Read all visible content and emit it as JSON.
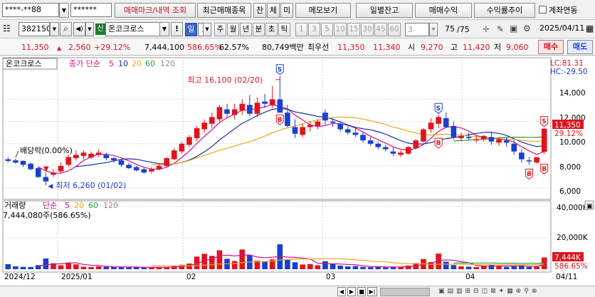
{
  "top": {
    "account": "****-**88",
    "password": "******",
    "buttons": [
      "매매마크/내역 조회",
      "최근매매종목",
      "잔",
      "체",
      "미",
      "메모보기",
      "일별잔고",
      "매매수익",
      "수익률추이"
    ],
    "link_check_label": "계좌연동"
  },
  "toolbar": {
    "code": "382150",
    "credit_badge": "신",
    "stock_name": "온코크로스",
    "exclaim": "!",
    "period_selected": "일",
    "period_value": "3",
    "periods": [
      "주",
      "월",
      "년",
      "분",
      "초",
      "틱"
    ],
    "intervals": [
      "1",
      "3",
      "5",
      "10",
      "15",
      "30",
      "45",
      "60"
    ],
    "interval_value": "3",
    "count_label": "75",
    "count_total": "/75",
    "date": "2025/04/11"
  },
  "quote": {
    "price": "11,350",
    "change": "2,560",
    "change_pct": "+29.12%",
    "volume": "7,444,100",
    "vol_ratio": "586.65%",
    "turnover": "62.57%",
    "amount": "80,749백만",
    "best_bid_label": "최우선",
    "ask": "11,350",
    "bid": "11,340",
    "open_label": "시",
    "open": "9,270",
    "high_label": "고",
    "high": "11,420",
    "low_label": "저",
    "low": "9,060",
    "buy_label": "매수",
    "sell_label": "매도"
  },
  "price_panel": {
    "name": "온코크로스",
    "ma_title": "종가 단순",
    "ma_periods": [
      "5",
      "10",
      "20",
      "60",
      "120"
    ],
    "ma_colors": [
      "#d0108e",
      "#1c2fa0",
      "#e8a818",
      "#1fa23a",
      "#8a8a8a"
    ],
    "lc": "LC:81.31",
    "hc": "HC:-29.50",
    "high_annot": "최고 16,100 (02/20)",
    "low_annot": "최저 6,260 (01/02)",
    "dividend_annot": "배당락(0.00%)",
    "y_ticks": [
      "14,000",
      "12,000",
      "10,000",
      "8,000",
      "6,000"
    ],
    "last_price_tag": "11,350",
    "last_pct_tag": "29.12%"
  },
  "volume_panel": {
    "name": "거래량",
    "ma_title": "단순",
    "ma_periods": [
      "5",
      "20",
      "60",
      "120"
    ],
    "ma_colors": [
      "#d0108e",
      "#e8a818",
      "#1fa23a",
      "#8a8a8a"
    ],
    "last_value": "7,444,080주(586.65%)",
    "y_ticks": [
      "40,000K",
      "20,000K"
    ],
    "last_vol_tag": "7,444K",
    "last_pct_tag": "586.65%"
  },
  "x_labels": [
    "2024/12",
    "2025/01",
    "02",
    "03",
    "04",
    "04/11"
  ],
  "chart_data": {
    "type": "candlestick",
    "x": [
      "2024/12/23",
      "2024/12/24",
      "2024/12/26",
      "2024/12/27",
      "2024/12/30",
      "2025/01/02",
      "2025/01/03",
      "2025/01/06",
      "2025/01/07",
      "2025/01/08",
      "2025/01/09",
      "2025/01/10",
      "2025/01/13",
      "2025/01/14",
      "2025/01/15",
      "2025/01/16",
      "2025/01/17",
      "2025/01/20",
      "2025/01/21",
      "2025/01/22",
      "2025/01/23",
      "2025/01/24",
      "2025/01/31",
      "2025/02/03",
      "2025/02/04",
      "2025/02/05",
      "2025/02/06",
      "2025/02/07",
      "2025/02/10",
      "2025/02/11",
      "2025/02/12",
      "2025/02/13",
      "2025/02/14",
      "2025/02/17",
      "2025/02/18",
      "2025/02/19",
      "2025/02/20",
      "2025/02/21",
      "2025/02/24",
      "2025/02/25",
      "2025/02/26",
      "2025/02/27",
      "2025/02/28",
      "2025/03/04",
      "2025/03/05",
      "2025/03/06",
      "2025/03/07",
      "2025/03/10",
      "2025/03/11",
      "2025/03/12",
      "2025/03/13",
      "2025/03/14",
      "2025/03/17",
      "2025/03/18",
      "2025/03/19",
      "2025/03/20",
      "2025/03/21",
      "2025/03/24",
      "2025/03/25",
      "2025/03/26",
      "2025/03/27",
      "2025/03/28",
      "2025/03/31",
      "2025/04/01",
      "2025/04/02",
      "2025/04/03",
      "2025/04/04",
      "2025/04/07",
      "2025/04/08",
      "2025/04/09",
      "2025/04/10",
      "2025/04/11"
    ],
    "open": [
      8600,
      8500,
      8450,
      8200,
      7800,
      7000,
      7200,
      7500,
      8100,
      8700,
      8900,
      8750,
      9000,
      9000,
      8700,
      8500,
      8100,
      7900,
      7700,
      7500,
      7700,
      8000,
      8600,
      9300,
      9900,
      10500,
      11300,
      11800,
      12200,
      13100,
      12600,
      13000,
      13500,
      12700,
      13800,
      13500,
      14000,
      12800,
      11500,
      10800,
      11500,
      11600,
      12800,
      12000,
      11800,
      11300,
      11000,
      10800,
      10300,
      10000,
      9700,
      9300,
      9000,
      9100,
      9600,
      10200,
      11300,
      11800,
      12300,
      11600,
      10500,
      10600,
      10300,
      10400,
      10600,
      10100,
      10300,
      10000,
      9200,
      8500,
      8300,
      9270
    ],
    "high": [
      8800,
      8650,
      8500,
      8300,
      7900,
      7400,
      7700,
      8300,
      9000,
      9400,
      9400,
      9300,
      9500,
      9200,
      8800,
      8600,
      8300,
      8000,
      7900,
      7900,
      8200,
      8800,
      9600,
      10200,
      10800,
      11600,
      12200,
      12800,
      13500,
      13600,
      13600,
      14000,
      14400,
      14200,
      14500,
      15200,
      16100,
      13500,
      12200,
      11800,
      12000,
      12200,
      13100,
      12300,
      12000,
      11600,
      11400,
      11100,
      10600,
      10200,
      9900,
      9700,
      9400,
      9800,
      10400,
      11400,
      12300,
      12600,
      12800,
      12000,
      11000,
      11000,
      10800,
      10800,
      11100,
      10600,
      10600,
      10300,
      9500,
      8800,
      8600,
      11420
    ],
    "low": [
      8300,
      8200,
      7900,
      7600,
      6900,
      6260,
      7000,
      7300,
      7900,
      8500,
      8600,
      8600,
      8800,
      8500,
      8300,
      7900,
      7700,
      7500,
      7300,
      7300,
      7600,
      7900,
      8500,
      9100,
      9700,
      10200,
      11000,
      11400,
      12000,
      12300,
      12200,
      12600,
      12500,
      12400,
      13200,
      13200,
      13500,
      11500,
      10500,
      10600,
      11100,
      11300,
      11700,
      11500,
      11100,
      10800,
      10600,
      10100,
      9800,
      9500,
      9300,
      8900,
      8800,
      9000,
      9500,
      10100,
      11000,
      11400,
      11400,
      10400,
      10200,
      10300,
      10100,
      10200,
      9900,
      9800,
      9700,
      9000,
      8300,
      8100,
      8200,
      9060
    ],
    "close": [
      8450,
      8300,
      8100,
      7700,
      7000,
      6600,
      7400,
      8000,
      8800,
      9000,
      9200,
      9100,
      9200,
      8700,
      8500,
      8100,
      7800,
      7600,
      7400,
      7700,
      8000,
      8700,
      9400,
      10000,
      10600,
      11400,
      11900,
      12400,
      13300,
      12700,
      13100,
      13600,
      12700,
      13700,
      13600,
      14000,
      12800,
      11600,
      10900,
      11500,
      11700,
      12000,
      12100,
      11900,
      11300,
      11000,
      10800,
      10300,
      10000,
      9700,
      9500,
      9100,
      9200,
      9700,
      10300,
      11300,
      11900,
      12400,
      11500,
      10600,
      10700,
      10500,
      10400,
      10700,
      10200,
      10400,
      10100,
      9300,
      8600,
      8400,
      8790,
      11350
    ],
    "volume_k": [
      3200,
      1800,
      1500,
      1400,
      2600,
      6800,
      3800,
      2500,
      4200,
      3100,
      1600,
      1300,
      1800,
      1600,
      1400,
      1300,
      1200,
      1400,
      1100,
      900,
      1200,
      1300,
      2300,
      2800,
      3600,
      8000,
      9800,
      8500,
      12000,
      6600,
      5200,
      12500,
      8800,
      5400,
      5000,
      6200,
      15800,
      6000,
      4400,
      3000,
      3300,
      2500,
      5100,
      3200,
      2300,
      1800,
      2000,
      1500,
      1300,
      1500,
      1200,
      1700,
      1400,
      2300,
      3900,
      6500,
      4500,
      9900,
      4800,
      2600,
      1800,
      1600,
      1400,
      2200,
      2800,
      2300,
      1500,
      1800,
      2400,
      1500,
      1600,
      7444
    ],
    "ylim_price": [
      5300,
      16600
    ],
    "ylim_volume_k": [
      0,
      42000
    ]
  },
  "footer": {
    "nav_labels": [
      "◀",
      "▶",
      "■",
      "▶|"
    ]
  }
}
